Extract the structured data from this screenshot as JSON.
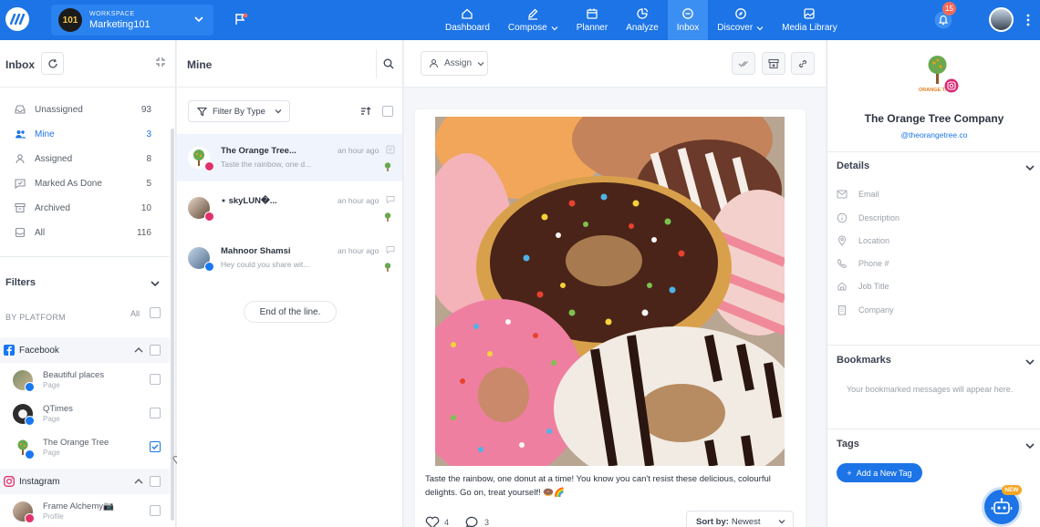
{
  "topbar": {
    "workspace_label": "WORKSPACE",
    "workspace_name": "Marketing101",
    "workspace_avatar_text": "101",
    "nav": [
      {
        "label": "Dashboard",
        "icon": "home-icon",
        "active": false
      },
      {
        "label": "Compose",
        "icon": "pencil-icon",
        "active": false,
        "dropdown": true
      },
      {
        "label": "Planner",
        "icon": "calendar-icon",
        "active": false
      },
      {
        "label": "Analyze",
        "icon": "analytics-icon",
        "active": false
      },
      {
        "label": "Inbox",
        "icon": "chat-icon",
        "active": true
      },
      {
        "label": "Discover",
        "icon": "compass-icon",
        "active": false,
        "dropdown": true
      },
      {
        "label": "Media Library",
        "icon": "media-icon",
        "active": false
      }
    ],
    "notification_count": "15",
    "brand_color": "#1c74e6"
  },
  "inbox_panel": {
    "title": "Inbox",
    "folders": [
      {
        "label": "Unassigned",
        "count": "93",
        "icon": "inbox-icon"
      },
      {
        "label": "Mine",
        "count": "3",
        "icon": "users-icon",
        "active": true
      },
      {
        "label": "Assigned",
        "count": "8",
        "icon": "user-icon"
      },
      {
        "label": "Marked As Done",
        "count": "5",
        "icon": "check-message-icon"
      },
      {
        "label": "Archived",
        "count": "10",
        "icon": "archive-icon"
      },
      {
        "label": "All",
        "count": "116",
        "icon": "all-inbox-icon"
      }
    ],
    "filters_title": "Filters",
    "by_platform_label": "BY PLATFORM",
    "all_label": "All",
    "platforms": [
      {
        "name": "Facebook",
        "accounts": [
          {
            "name": "Beautiful places",
            "type": "Page",
            "checked": false
          },
          {
            "name": "QTimes",
            "type": "Page",
            "checked": false
          },
          {
            "name": "The Orange Tree",
            "type": "Page",
            "checked": true
          }
        ]
      },
      {
        "name": "Instagram",
        "accounts": [
          {
            "name": "Frame Alchemy📷",
            "type": "Profile",
            "checked": false
          }
        ]
      }
    ]
  },
  "conversation_panel": {
    "title": "Mine",
    "filter_label": "Filter By Type",
    "conversations": [
      {
        "name": "The Orange Tree...",
        "preview": "Taste the rainbow, one d...",
        "time": "an hour ago",
        "platform": "instagram",
        "selected": true
      },
      {
        "name": "⋆ skyLUN�...",
        "preview": "",
        "time": "an hour ago",
        "platform": "instagram",
        "selected": false
      },
      {
        "name": "Mahnoor Shamsi",
        "preview": "Hey could you share wit...",
        "time": "an hour ago",
        "platform": "facebook",
        "selected": false
      }
    ],
    "end_label": "End of the line."
  },
  "detail_panel": {
    "assign_label": "Assign",
    "caption": "Taste the rainbow, one donut at a time! You know you can't resist these delicious, colourful delights. Go on, treat yourself! 🍩🌈",
    "likes": "4",
    "comments": "3",
    "sort_prefix": "Sort by:",
    "sort_value": "Newest"
  },
  "profile_panel": {
    "logo_text": "ORANGE TREE",
    "company_name": "The Orange Tree Company",
    "handle": "@theorangetree.co",
    "details_title": "Details",
    "fields": [
      {
        "label": "Email",
        "icon": "email-icon"
      },
      {
        "label": "Description",
        "icon": "info-icon"
      },
      {
        "label": "Location",
        "icon": "location-icon"
      },
      {
        "label": "Phone #",
        "icon": "phone-icon"
      },
      {
        "label": "Job Title",
        "icon": "briefcase-icon"
      },
      {
        "label": "Company",
        "icon": "building-icon"
      }
    ],
    "bookmarks_title": "Bookmarks",
    "bookmarks_empty": "Your bookmarked messages will appear here.",
    "tags_title": "Tags",
    "add_tag_label": "Add a New Tag",
    "new_badge": "NEW"
  }
}
